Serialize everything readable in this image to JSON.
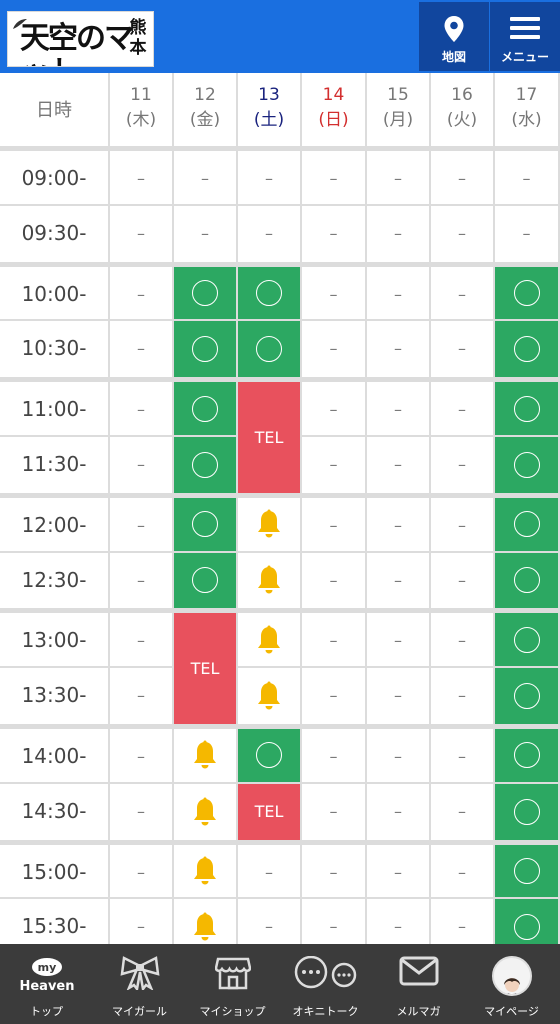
{
  "header": {
    "logo_main": "天空のマット",
    "logo_vertical": "熊本",
    "map_label": "地図",
    "menu_label": "メニュー"
  },
  "schedule": {
    "corner_label": "日時",
    "days": [
      {
        "date": "11",
        "weekday": "(木)",
        "type": "weekday"
      },
      {
        "date": "12",
        "weekday": "(金)",
        "type": "weekday"
      },
      {
        "date": "13",
        "weekday": "(土)",
        "type": "sat"
      },
      {
        "date": "14",
        "weekday": "(日)",
        "type": "sun"
      },
      {
        "date": "15",
        "weekday": "(月)",
        "type": "weekday"
      },
      {
        "date": "16",
        "weekday": "(火)",
        "type": "weekday"
      },
      {
        "date": "17",
        "weekday": "(水)",
        "type": "weekday"
      }
    ],
    "times": [
      "09:00-",
      "09:30-",
      "10:00-",
      "10:30-",
      "11:00-",
      "11:30-",
      "12:00-",
      "12:30-",
      "13:00-",
      "13:30-",
      "14:00-",
      "14:30-",
      "15:00-",
      "15:30-"
    ],
    "rows": [
      [
        "dash",
        "dash",
        "dash",
        "dash",
        "dash",
        "dash",
        "dash"
      ],
      [
        "dash",
        "dash",
        "dash",
        "dash",
        "dash",
        "dash",
        "dash"
      ],
      [
        "dash",
        "circle",
        "circle",
        "dash",
        "dash",
        "dash",
        "circle"
      ],
      [
        "dash",
        "circle",
        "circle",
        "dash",
        "dash",
        "dash",
        "circle"
      ],
      [
        "dash",
        "circle",
        "tel2",
        "dash",
        "dash",
        "dash",
        "circle"
      ],
      [
        "dash",
        "circle",
        "skip",
        "dash",
        "dash",
        "dash",
        "circle"
      ],
      [
        "dash",
        "circle",
        "bell",
        "dash",
        "dash",
        "dash",
        "circle"
      ],
      [
        "dash",
        "circle",
        "bell",
        "dash",
        "dash",
        "dash",
        "circle"
      ],
      [
        "dash",
        "tel2",
        "bell",
        "dash",
        "dash",
        "dash",
        "circle"
      ],
      [
        "dash",
        "skip",
        "bell",
        "dash",
        "dash",
        "dash",
        "circle"
      ],
      [
        "dash",
        "bell",
        "circle",
        "dash",
        "dash",
        "dash",
        "circle"
      ],
      [
        "dash",
        "bell",
        "tel",
        "dash",
        "dash",
        "dash",
        "circle"
      ],
      [
        "dash",
        "bell",
        "dash",
        "dash",
        "dash",
        "dash",
        "circle"
      ],
      [
        "dash",
        "bell",
        "dash",
        "dash",
        "dash",
        "dash",
        "circle"
      ]
    ],
    "dash_text": "–",
    "tel_text": "TEL"
  },
  "nav": {
    "items": [
      {
        "label": "トップ",
        "icon": "my-heaven-icon",
        "badge_top": "my",
        "badge_bottom": "Heaven"
      },
      {
        "label": "マイガール",
        "icon": "ribbon-icon"
      },
      {
        "label": "マイショップ",
        "icon": "shop-icon"
      },
      {
        "label": "オキニトーク",
        "icon": "chat-icon"
      },
      {
        "label": "メルマガ",
        "icon": "mail-icon"
      },
      {
        "label": "マイページ",
        "icon": "avatar-icon"
      }
    ]
  },
  "colors": {
    "header_blue": "#1a6fe0",
    "header_button": "#11469e",
    "available_green": "#2ca862",
    "tel_red": "#e8515d",
    "bell_yellow": "#f5b800",
    "saturday_navy": "#1a237e",
    "sunday_red": "#d32f2f",
    "nav_bg": "#3b3b3b"
  }
}
